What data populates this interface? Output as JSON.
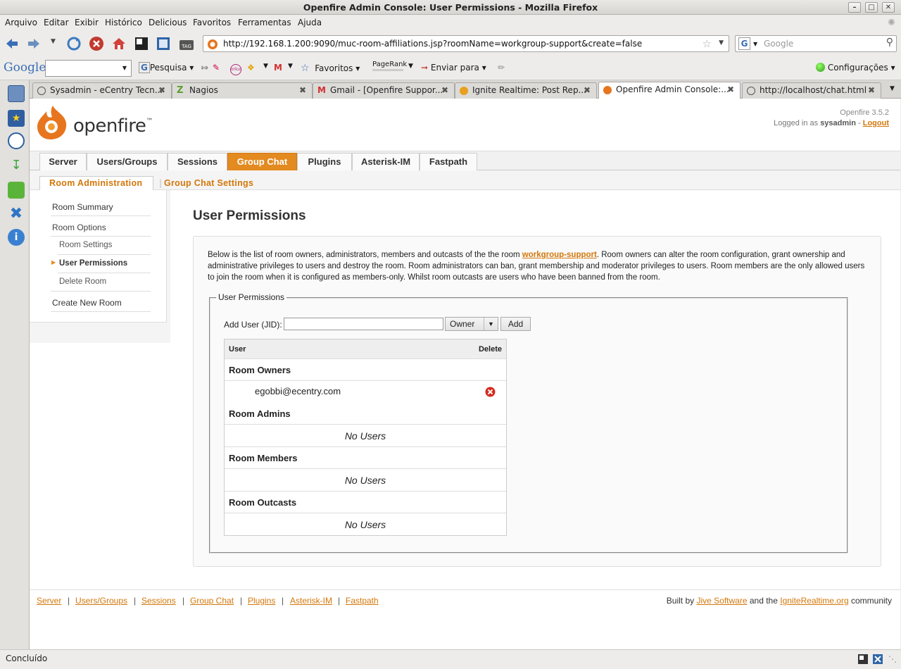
{
  "window": {
    "title": "Openfire Admin Console: User Permissions - Mozilla Firefox"
  },
  "menu": [
    "Arquivo",
    "Editar",
    "Exibir",
    "Histórico",
    "Delicious",
    "Favoritos",
    "Ferramentas",
    "Ajuda"
  ],
  "nav": {
    "url": "http://192.168.1.200:9090/muc-room-affiliations.jsp?roomName=workgroup-support&create=false",
    "search_placeholder": "Google"
  },
  "google_toolbar": {
    "logo": "Google",
    "search_label": "Pesquisa",
    "favorites": "Favoritos",
    "pagerank": "PageRank",
    "send_to": "Enviar para",
    "settings": "Configurações"
  },
  "tabs": [
    {
      "label": "Sysadmin - eCentry Tecn..."
    },
    {
      "label": "Nagios"
    },
    {
      "label": "Gmail - [Openfire Suppor..."
    },
    {
      "label": "Ignite Realtime: Post Rep..."
    },
    {
      "label": "Openfire Admin Console:..."
    },
    {
      "label": "http://localhost/chat.html"
    }
  ],
  "header": {
    "logo_text": "openfire",
    "tm": "™",
    "version": "Openfire 3.5.2",
    "logged_in_prefix": "Logged in as",
    "username": "sysadmin",
    "dash": "-",
    "logout": "Logout"
  },
  "main_tabs": [
    "Server",
    "Users/Groups",
    "Sessions",
    "Group Chat",
    "Plugins",
    "Asterisk-IM",
    "Fastpath"
  ],
  "sub_tabs": [
    "Room Administration",
    "Group Chat Settings"
  ],
  "sidenav": {
    "room_summary": "Room Summary",
    "room_options": "Room Options",
    "room_settings": "Room Settings",
    "user_permissions": "User Permissions",
    "delete_room": "Delete Room",
    "create_new_room": "Create New Room"
  },
  "page": {
    "title": "User Permissions",
    "desc_part1": "Below is the list of room owners, administrators, members and outcasts of the the room ",
    "room_link": "workgroup-support",
    "desc_part2": ". Room owners can alter the room configuration, grant ownership and administrative privileges to users and destroy the room. Room administrators can ban, grant membership and moderator privileges to users. Room members are the only allowed users to join the room when it is configured as members-only. Whilst room outcasts are users who have been banned from the room.",
    "fieldset_legend": "User Permissions",
    "add_user_label": "Add User (JID):",
    "role_selected": "Owner",
    "add_button": "Add",
    "col_user": "User",
    "col_delete": "Delete",
    "sections": {
      "owners": "Room Owners",
      "admins": "Room Admins",
      "members": "Room Members",
      "outcasts": "Room Outcasts"
    },
    "owner_entry": "egobbi@ecentry.com",
    "no_users": "No Users"
  },
  "footer": {
    "links": [
      "Server",
      "Users/Groups",
      "Sessions",
      "Group Chat",
      "Plugins",
      "Asterisk-IM",
      "Fastpath"
    ],
    "separator": "|",
    "built_by": "Built by",
    "jive": "Jive Software",
    "and_the": "and the",
    "ignite": "IgniteRealtime.org",
    "community": "community"
  },
  "status": {
    "text": "Concluído"
  },
  "colors": {
    "accent": "#e38a20",
    "link": "#d3770a"
  }
}
